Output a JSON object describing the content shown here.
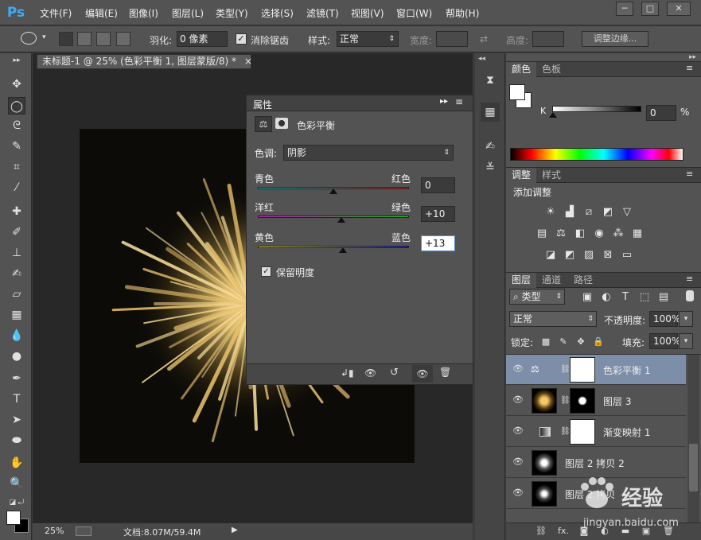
{
  "app": {
    "logo": "Ps"
  },
  "menu": [
    "文件(F)",
    "编辑(E)",
    "图像(I)",
    "图层(L)",
    "类型(Y)",
    "选择(S)",
    "滤镜(T)",
    "视图(V)",
    "窗口(W)",
    "帮助(H)"
  ],
  "window_controls": {
    "minimize": "─",
    "restore": "□",
    "close": "✕"
  },
  "options": {
    "feather_label": "羽化:",
    "feather_value": "0 像素",
    "antialias_label": "消除锯齿",
    "antialias_checked": true,
    "style_label": "样式:",
    "style_value": "正常",
    "width_label": "宽度:",
    "height_label": "高度:",
    "refine_edge": "调整边缘..."
  },
  "document": {
    "tab_title": "未标题-1 @ 25% (色彩平衡 1, 图层蒙版/8) *",
    "tab_close": "×",
    "zoom": "25%",
    "doc_info": "文档:8.07M/59.4M"
  },
  "properties": {
    "panel_title": "属性",
    "adjustment_name": "色彩平衡",
    "tone_label": "色调:",
    "tone_value": "阴影",
    "sliders": [
      {
        "left": "青色",
        "right": "红色",
        "value": "0",
        "fraction": 0.5
      },
      {
        "left": "洋红",
        "right": "绿色",
        "value": "+10",
        "fraction": 0.55
      },
      {
        "left": "黄色",
        "right": "蓝色",
        "value": "+13",
        "fraction": 0.565
      }
    ],
    "preserve_luminosity": "保留明度",
    "preserve_checked": true
  },
  "color_panel": {
    "tabs": [
      "颜色",
      "色板"
    ],
    "channel": "K",
    "value": "0",
    "unit": "%"
  },
  "adjustments_panel": {
    "tabs": [
      "调整",
      "样式"
    ],
    "add_label": "添加调整"
  },
  "layers_panel": {
    "tabs": [
      "图层",
      "通道",
      "路径"
    ],
    "filter_kind": "类型",
    "blend_mode": "正常",
    "opacity_label": "不透明度:",
    "opacity_value": "100%",
    "lock_label": "锁定:",
    "fill_label": "填充:",
    "fill_value": "100%",
    "layers": [
      {
        "name": "色彩平衡 1",
        "selected": true
      },
      {
        "name": "图层 3",
        "selected": false
      },
      {
        "name": "渐变映射 1",
        "selected": false
      },
      {
        "name": "图层 2 拷贝 2",
        "selected": false
      },
      {
        "name": "图层 2 拷贝",
        "selected": false
      }
    ],
    "bottom_icons": [
      "link-icon",
      "fx-icon",
      "mask-icon",
      "adjustment-icon",
      "group-icon",
      "new-layer-icon",
      "trash-icon"
    ]
  },
  "watermark": {
    "brand": "经验",
    "url": "jingyan.baidu.com"
  }
}
